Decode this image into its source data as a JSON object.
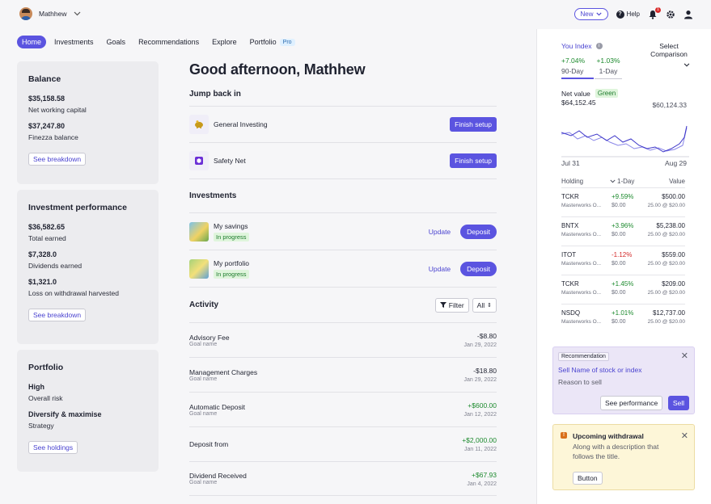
{
  "user": {
    "name": "Mathhew"
  },
  "top": {
    "new_label": "New",
    "help_label": "Help",
    "notif_count": "1"
  },
  "nav": {
    "items": [
      "Home",
      "Investments",
      "Goals",
      "Recommendations",
      "Explore",
      "Portfolio"
    ],
    "pro_badge": "Pro"
  },
  "balance": {
    "title": "Balance",
    "items": [
      {
        "value": "$35,158.58",
        "label": "Net working capital"
      },
      {
        "value": "$37,247.80",
        "label": "Finezza balance"
      }
    ],
    "button": "See breakdown"
  },
  "performance": {
    "title": "Investment performance",
    "items": [
      {
        "value": "$36,582.65",
        "label": "Total earned"
      },
      {
        "value": "$7,328.0",
        "label": "Dividends earned"
      },
      {
        "value": "$1,321.0",
        "label": "Loss on withdrawal harvested"
      }
    ],
    "button": "See breakdown"
  },
  "portfolio": {
    "title": "Portfolio",
    "items": [
      {
        "value": "High",
        "label": "Overall risk"
      },
      {
        "value": "Diversify & maximise",
        "label": "Strategy"
      }
    ],
    "button": "See holdings"
  },
  "main": {
    "greeting": "Good afternoon, Mathhew",
    "jump_title": "Jump back in",
    "jump_items": [
      {
        "name": "General Investing",
        "button": "Finish setup"
      },
      {
        "name": "Safety Net",
        "button": "Finish setup"
      }
    ],
    "inv_title": "Investments",
    "investments": [
      {
        "name": "My savings",
        "status": "In progress",
        "update": "Update",
        "deposit": "Deposit"
      },
      {
        "name": "My portfolio",
        "status": "In progress",
        "update": "Update",
        "deposit": "Deposit"
      }
    ],
    "activity_title": "Activity",
    "filter_label": "Filter",
    "all_label": "All",
    "activity": [
      {
        "title": "Advisory Fee",
        "sub": "Goal name",
        "amount": "-$8.80",
        "date": "Jan 29, 2022",
        "kind": "neutral"
      },
      {
        "title": "Management Charges",
        "sub": "Goal name",
        "amount": "-$18.80",
        "date": "Jan 29, 2022",
        "kind": "neutral"
      },
      {
        "title": "Automatic Deposit",
        "sub": "Goal name",
        "amount": "+$600.00",
        "date": "Jan 12, 2022",
        "kind": "pos"
      },
      {
        "title": "Deposit from",
        "sub": "",
        "amount": "+$2,000.00",
        "date": "Jan 11, 2022",
        "kind": "pos"
      },
      {
        "title": "Dividend Received",
        "sub": "Goal name",
        "amount": "+$67.93",
        "date": "Jan 4, 2022",
        "kind": "pos"
      }
    ]
  },
  "index": {
    "tab_you": "You Index",
    "select_label": "Select Comparison",
    "p1_value": "+7.04%",
    "p1_period": "90-Day",
    "p2_value": "+1.03%",
    "p2_period": "1-Day",
    "net_label": "Net value",
    "green_badge": "Green",
    "net_value_left": "$64,152.45",
    "net_value_right": "$60,124.33",
    "date_start": "Jul 31",
    "date_end": "Aug 29",
    "chart_line_color": "#5b54e0",
    "head_holding": "Holding",
    "head_day": "1-Day",
    "head_value": "Value",
    "holdings": [
      {
        "ticker": "TCKR",
        "sub": "Masterworks O...",
        "chg": "+9.59%",
        "price": "$0.00",
        "value": "$500.00",
        "calc": "25.00 @ $20.00",
        "kind": "pos"
      },
      {
        "ticker": "BNTX",
        "sub": "Masterworks O...",
        "chg": "+3.96%",
        "price": "$0.00",
        "value": "$5,238.00",
        "calc": "25.00 @ $20.00",
        "kind": "pos"
      },
      {
        "ticker": "ITOT",
        "sub": "Masterworks O...",
        "chg": "-1.12%",
        "price": "$0.00",
        "value": "$559.00",
        "calc": "25.00 @ $20.00",
        "kind": "neg"
      },
      {
        "ticker": "TCKR",
        "sub": "Masterworks O...",
        "chg": "+1.45%",
        "price": "$0.00",
        "value": "$209.00",
        "calc": "25.00 @ $20.00",
        "kind": "pos"
      },
      {
        "ticker": "NSDQ",
        "sub": "Masterworks O...",
        "chg": "+1.01%",
        "price": "$0.00",
        "value": "$12,737.00",
        "calc": "25.00 @ $20.00",
        "kind": "pos"
      }
    ]
  },
  "recommendation": {
    "tag": "Recommendation",
    "title": "Sell Name of stock or index",
    "reason": "Reason to sell",
    "see_perf": "See performance",
    "sell": "Sell"
  },
  "withdrawal": {
    "title": "Upcoming withdrawal",
    "desc": "Along with a description that follows the title.",
    "button": "Button"
  }
}
